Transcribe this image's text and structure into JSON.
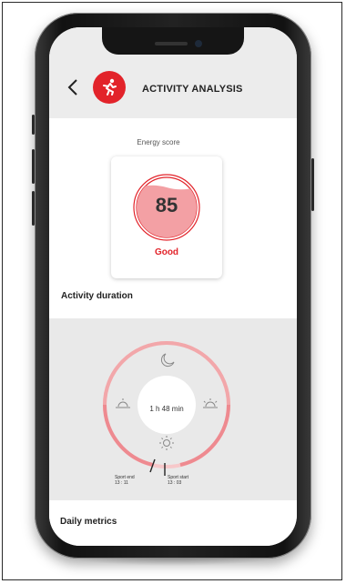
{
  "header": {
    "title": "ACTIVITY ANALYSIS",
    "back_icon": "chevron-left-icon",
    "badge_icon": "runner-icon"
  },
  "energy": {
    "label": "Energy score",
    "score": "85",
    "rating": "Good",
    "fill_level": 0.72
  },
  "duration": {
    "heading": "Activity duration",
    "center_text": "1 h 48 min",
    "sport_end_label": "Sport end",
    "sport_end_time": "13 : 11",
    "sport_start_label": "Sport start",
    "sport_start_time": "13 : 03",
    "icons": [
      "moon-icon",
      "sunset-icon",
      "sunrise-icon",
      "sun-icon"
    ]
  },
  "daily": {
    "heading": "Daily metrics"
  },
  "colors": {
    "accent": "#e2232a",
    "ring": "#f2a7aa",
    "ring_light": "#f7c8ca",
    "panel_gray": "#e9e9e9"
  }
}
